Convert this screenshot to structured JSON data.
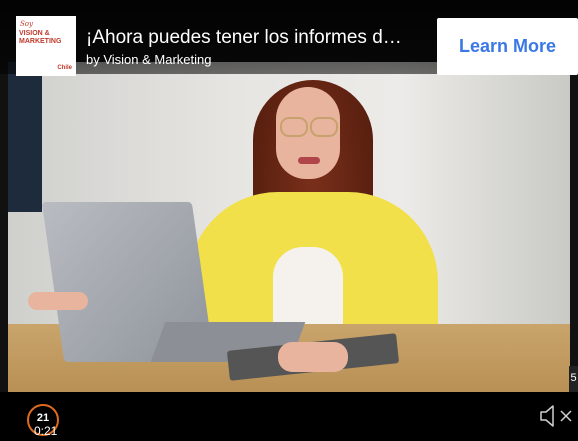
{
  "ad": {
    "title": "¡Ahora puedes tener los informes d…",
    "byline": "by Vision & Marketing",
    "cta_label": "Learn More",
    "logo": {
      "line1": "Soy",
      "line2": "VISION & MARKETING",
      "line3": "Chile"
    }
  },
  "player": {
    "countdown": "21",
    "current_time": "0:21",
    "side_label": "5",
    "mute_icon": "speaker-muted-icon",
    "accent_color": "#e06b1d"
  },
  "colors": {
    "cta_text": "#3a78e6",
    "jacket": "#f2e04a"
  }
}
